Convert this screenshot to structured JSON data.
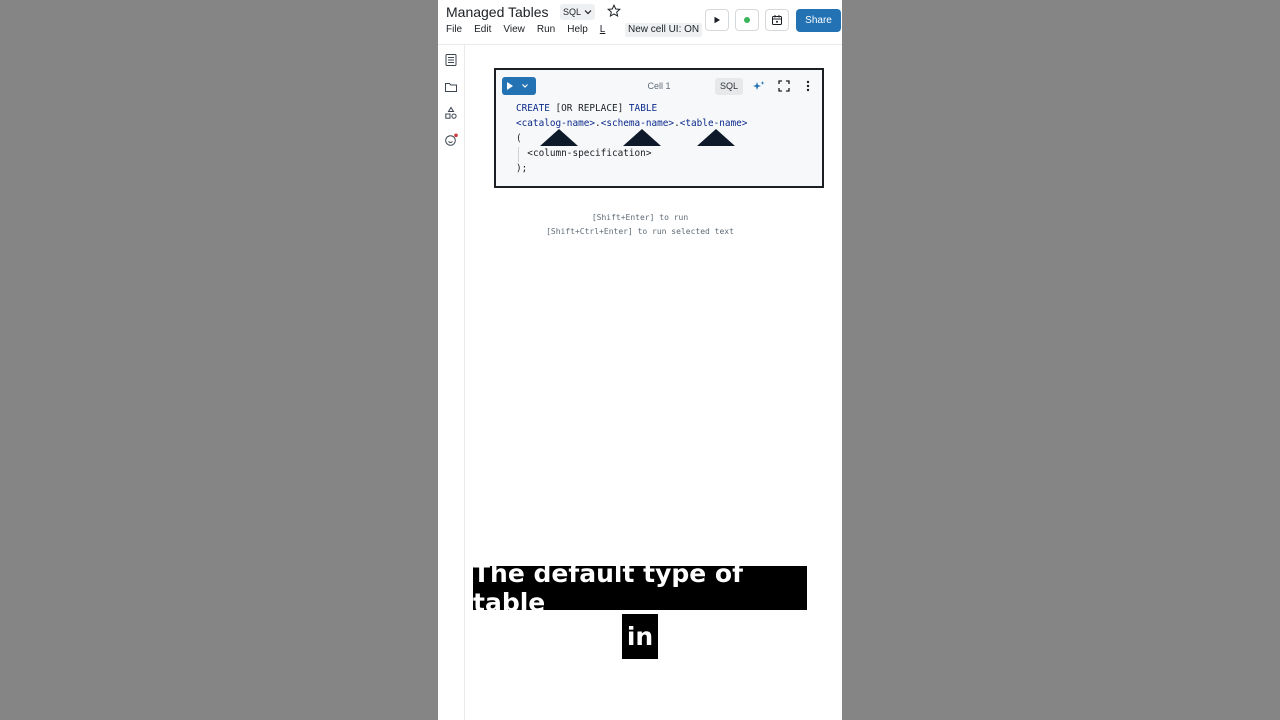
{
  "header": {
    "title": "Managed Tables",
    "language": "SQL",
    "menu": [
      "File",
      "Edit",
      "View",
      "Run",
      "Help",
      "L"
    ],
    "new_cell_ui": "New cell UI: ON",
    "share_label": "Share",
    "status_color": "#3cb55a",
    "accent_color": "#2272b4"
  },
  "sidebar": {
    "icons": [
      "table-of-contents-icon",
      "folder-icon",
      "shapes-icon",
      "assistant-icon"
    ]
  },
  "cell": {
    "label": "Cell 1",
    "language": "SQL",
    "code": {
      "line1": {
        "kw1": "CREATE",
        "mid": " [OR REPLACE] ",
        "kw2": "TABLE"
      },
      "line2": {
        "a": "<catalog-name>",
        "dot1": ".",
        "b": "<schema-name>",
        "dot2": ".",
        "c": "<table-name>"
      },
      "line3": "(",
      "line4": "<column-specification>",
      "line5": ");"
    }
  },
  "hints": {
    "run": "[Shift+Enter] to run",
    "run_selected": "[Shift+Ctrl+Enter] to run selected text"
  },
  "caption": {
    "line1": "The default type of table",
    "line2": "in"
  }
}
